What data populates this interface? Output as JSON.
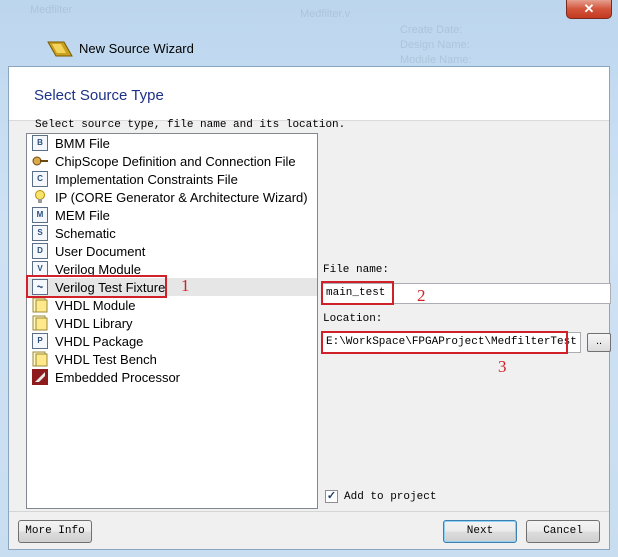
{
  "window": {
    "title": "New Source Wizard",
    "close_glyph": "✕",
    "accent_color": "#d0202a"
  },
  "header": {
    "title": "Select Source Type"
  },
  "instruction": "Select source type, file name and its location.",
  "source_types": [
    {
      "label": "BMM File",
      "icon": "bmm-file-icon"
    },
    {
      "label": "ChipScope Definition and Connection File",
      "icon": "chipscope-icon"
    },
    {
      "label": "Implementation Constraints File",
      "icon": "constraints-file-icon"
    },
    {
      "label": "IP (CORE Generator & Architecture Wizard)",
      "icon": "ip-core-icon"
    },
    {
      "label": "MEM File",
      "icon": "mem-file-icon"
    },
    {
      "label": "Schematic",
      "icon": "schematic-icon"
    },
    {
      "label": "User Document",
      "icon": "document-icon"
    },
    {
      "label": "Verilog Module",
      "icon": "verilog-module-icon"
    },
    {
      "label": "Verilog Test Fixture",
      "icon": "verilog-test-fixture-icon",
      "selected": true
    },
    {
      "label": "VHDL Module",
      "icon": "vhdl-module-icon"
    },
    {
      "label": "VHDL Library",
      "icon": "vhdl-library-icon"
    },
    {
      "label": "VHDL Package",
      "icon": "vhdl-package-icon"
    },
    {
      "label": "VHDL Test Bench",
      "icon": "vhdl-test-bench-icon"
    },
    {
      "label": "Embedded Processor",
      "icon": "embedded-processor-icon"
    }
  ],
  "file_name": {
    "label": "File name:",
    "value": "main_test"
  },
  "location": {
    "label": "Location:",
    "value": "E:\\WorkSpace\\FPGAProject\\MedfilterTest",
    "browse_label": ".."
  },
  "add_to_project": {
    "label": "Add to project",
    "checked": true
  },
  "annotations": [
    "1",
    "2",
    "3"
  ],
  "buttons": {
    "more_info": "More Info",
    "next": "Next",
    "cancel": "Cancel"
  }
}
